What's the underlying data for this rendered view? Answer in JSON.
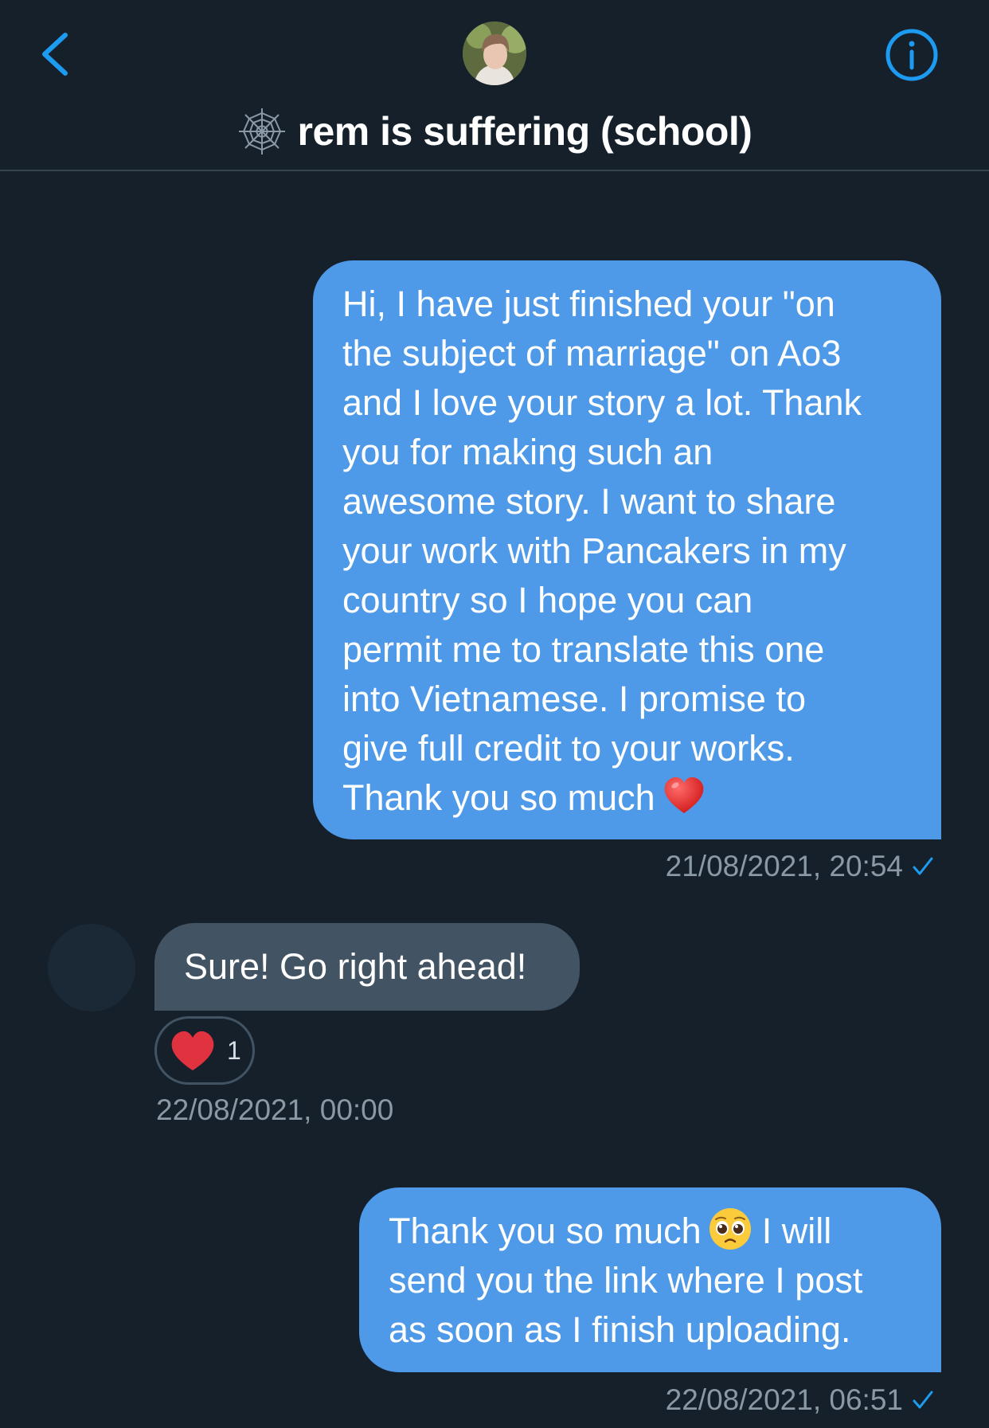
{
  "header": {
    "title": "rem is suffering (school)"
  },
  "messages": [
    {
      "direction": "outgoing",
      "lines": [
        "Hi, I have just finished your \"on",
        "the subject of marriage\" on Ao3",
        "and I love your story a lot. Thank",
        "you for making such an",
        "awesome story. I want to share",
        "your work with Pancakers in my",
        "country so I hope you can",
        "permit me to translate this one",
        "into Vietnamese. I promise to",
        "give full credit to your works.",
        "Thank you so much"
      ],
      "trailing_emoji": "red-heart",
      "timestamp": "21/08/2021, 20:54"
    },
    {
      "direction": "incoming",
      "text": "Sure! Go right ahead!",
      "reaction": {
        "emoji": "red-heart",
        "count": "1"
      },
      "timestamp": "22/08/2021, 00:00"
    },
    {
      "direction": "outgoing",
      "line1_before_emoji": "Thank you so much",
      "line1_after_emoji": "I will",
      "inline_emoji": "pleading-face",
      "line2": "send you the link where I post",
      "line3": "as soon as I finish uploading.",
      "timestamp": "22/08/2021, 06:51"
    }
  ],
  "colors": {
    "background": "#15202b",
    "outgoing_bubble": "#4e9ae8",
    "incoming_bubble": "#425363",
    "accent": "#1d9bf0",
    "timestamp": "#8b98a5",
    "divider": "#38444d"
  },
  "icons": {
    "back": "chevron-left-icon",
    "info": "info-icon",
    "title_prefix": "spider-web-icon",
    "read_receipt": "checkmark-icon"
  }
}
